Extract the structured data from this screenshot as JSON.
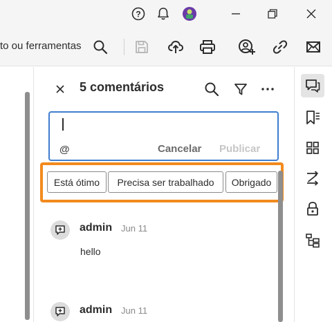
{
  "titlebar": {
    "help_icon": "help-circle-icon",
    "notifications_icon": "bell-icon",
    "avatar_icon": "user-avatar-icon",
    "window_buttons": [
      "minimize",
      "restore",
      "close"
    ]
  },
  "toolbar": {
    "search_hint": "to ou ferramentas",
    "tools": [
      "search-icon",
      "save-icon",
      "cloud-upload-icon",
      "print-icon",
      "share-user-icon",
      "link-icon",
      "email-icon"
    ]
  },
  "panel": {
    "title": "5 comentários",
    "comment_input": {
      "mention": "@",
      "cancel_label": "Cancelar",
      "publish_label": "Publicar"
    },
    "quick_replies": [
      "Está ótimo",
      "Precisa ser trabalhado",
      "Obrigado"
    ],
    "comments": [
      {
        "author": "admin",
        "date": "Jun 11",
        "text": "hello"
      },
      {
        "author": "admin",
        "date": "Jun 11",
        "text": ""
      }
    ]
  },
  "rail": {
    "items": [
      "comments-icon",
      "bookmarks-icon",
      "thumbnails-icon",
      "compare-icon",
      "protect-icon",
      "structure-icon"
    ]
  },
  "colors": {
    "highlight": "#f28a1e",
    "input_border": "#3f7dcf",
    "disabled": "#c6c6c6",
    "active_rail": "#e4e4e4"
  }
}
